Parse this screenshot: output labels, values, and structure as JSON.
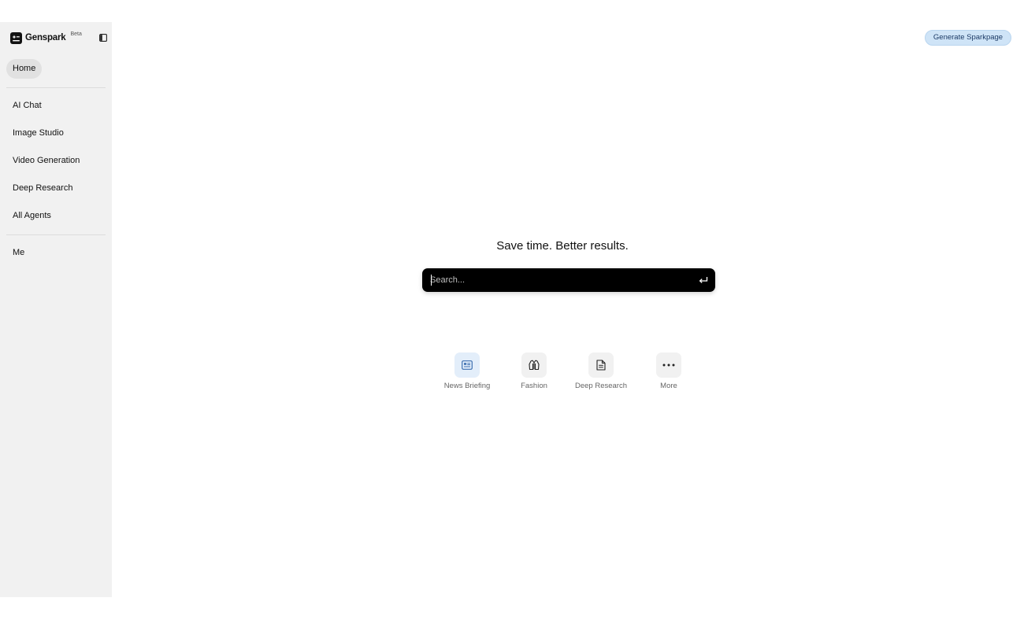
{
  "brand": {
    "name": "Genspark",
    "badge": "Beta"
  },
  "sidebar": {
    "items": [
      {
        "label": "Home"
      },
      {
        "label": "AI Chat"
      },
      {
        "label": "Image Studio"
      },
      {
        "label": "Video Generation"
      },
      {
        "label": "Deep Research"
      },
      {
        "label": "All Agents"
      },
      {
        "label": "Me"
      }
    ]
  },
  "header": {
    "generate_button": "Generate Sparkpage"
  },
  "main": {
    "headline": "Save time. Better results.",
    "search": {
      "placeholder": "Search...",
      "value": ""
    },
    "quick_actions": [
      {
        "label": "News Briefing",
        "icon": "news-icon"
      },
      {
        "label": "Fashion",
        "icon": "jacket-icon"
      },
      {
        "label": "Deep Research",
        "icon": "document-icon"
      },
      {
        "label": "More",
        "icon": "more-dots-icon"
      }
    ]
  },
  "colors": {
    "sidebar_bg": "#f1f1f1",
    "search_bg": "#000000",
    "accent_button_bg": "#cfe4f7",
    "news_icon_bg": "#e3eefa"
  }
}
